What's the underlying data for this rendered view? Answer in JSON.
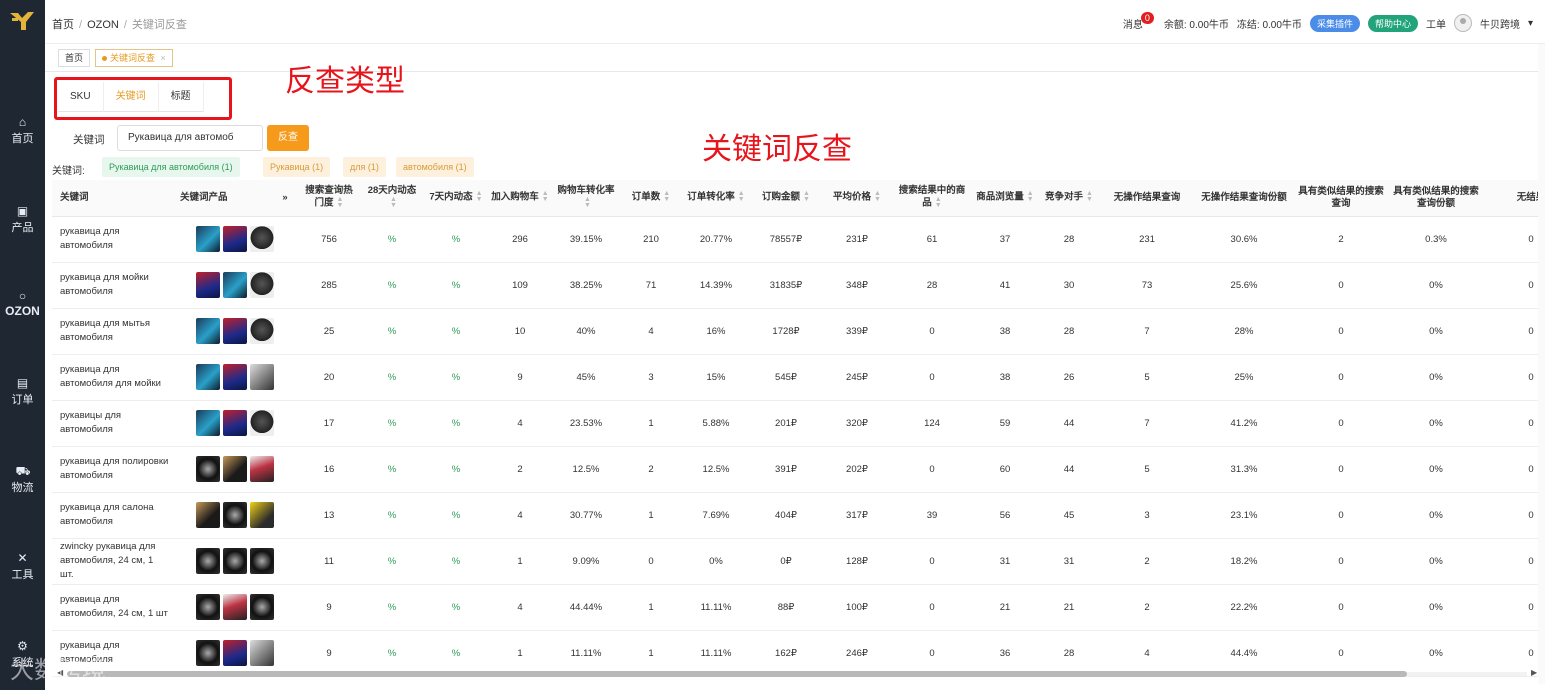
{
  "sidebar": {
    "items": [
      {
        "label": "首页",
        "icon": "home-icon"
      },
      {
        "label": "产品",
        "icon": "briefcase-icon"
      },
      {
        "label": "OZON",
        "icon": "ozon-icon"
      },
      {
        "label": "订单",
        "icon": "document-icon"
      },
      {
        "label": "物流",
        "icon": "truck-icon"
      },
      {
        "label": "工具",
        "icon": "tools-icon"
      },
      {
        "label": "系统",
        "icon": "gear-icon"
      }
    ]
  },
  "breadcrumb": [
    "首页",
    "OZON",
    "关键词反查"
  ],
  "header": {
    "messages_label": "消息",
    "messages_count": "0",
    "balance": "余额: 0.00牛币",
    "frozen": "冻结: 0.00牛币",
    "plugin_btn": "采集插件",
    "help_btn": "帮助中心",
    "ticket": "工单",
    "user": "牛贝跨境"
  },
  "page_tabs": [
    {
      "label": "首页",
      "active": false
    },
    {
      "label": "关键词反查",
      "active": true,
      "close": "×"
    }
  ],
  "query_tabs": [
    {
      "label": "SKU",
      "active": false
    },
    {
      "label": "关键词",
      "active": true
    },
    {
      "label": "标题",
      "active": false
    }
  ],
  "annotations": {
    "query_type": "反查类型",
    "keyword_lookup": "关键词反查"
  },
  "search": {
    "label": "关键词",
    "value": "Рукавица для автомоб",
    "button": "反查"
  },
  "chips": {
    "label": "关键词:",
    "items": [
      {
        "text": "Рукавица для автомобиля (1)",
        "style": "green"
      },
      {
        "text": "Рукавица (1)",
        "style": "orange"
      },
      {
        "text": "для (1)",
        "style": "orange"
      },
      {
        "text": "автомобиля (1)",
        "style": "orange"
      }
    ]
  },
  "table": {
    "headers": [
      "关键词",
      "关键词产品",
      "»",
      "搜索查询热门度",
      "28天内动态",
      "7天内动态",
      "加入购物车",
      "购物车转化率",
      "订单数",
      "订单转化率",
      "订购金额",
      "平均价格",
      "搜索结果中的商品",
      "商品浏览量",
      "竞争对手",
      "无操作结果查询",
      "无操作结果查询份额",
      "具有类似结果的搜索查询",
      "具有类似结果的搜索查询份额",
      "无结果"
    ],
    "rows": [
      {
        "keyword": "рукавица для автомобиля",
        "thumbs": [
          "t1",
          "t2",
          "t3"
        ],
        "popularity": "756",
        "d28": "%",
        "d7": "%",
        "cart": "296",
        "cart_rate": "39.15%",
        "orders": "210",
        "order_rate": "20.77%",
        "amount": "78557₽",
        "avg": "231₽",
        "results": "61",
        "views": "37",
        "competitors": "28",
        "noop": "231",
        "noop_share": "30.6%",
        "similar": "2",
        "similar_share": "0.3%",
        "last": "0"
      },
      {
        "keyword": "рукавица для мойки автомобиля",
        "thumbs": [
          "t2",
          "t1",
          "t3"
        ],
        "popularity": "285",
        "d28": "%",
        "d7": "%",
        "cart": "109",
        "cart_rate": "38.25%",
        "orders": "71",
        "order_rate": "14.39%",
        "amount": "31835₽",
        "avg": "348₽",
        "results": "28",
        "views": "41",
        "competitors": "30",
        "noop": "73",
        "noop_share": "25.6%",
        "similar": "0",
        "similar_share": "0%",
        "last": "0"
      },
      {
        "keyword": "рукавица для мытья автомобиля",
        "thumbs": [
          "t1",
          "t2",
          "t3"
        ],
        "popularity": "25",
        "d28": "%",
        "d7": "%",
        "cart": "10",
        "cart_rate": "40%",
        "orders": "4",
        "order_rate": "16%",
        "amount": "1728₽",
        "avg": "339₽",
        "results": "0",
        "views": "38",
        "competitors": "28",
        "noop": "7",
        "noop_share": "28%",
        "similar": "0",
        "similar_share": "0%",
        "last": "0"
      },
      {
        "keyword": "рукавица для автомобиля для мойки",
        "thumbs": [
          "t1",
          "t2",
          "t4"
        ],
        "popularity": "20",
        "d28": "%",
        "d7": "%",
        "cart": "9",
        "cart_rate": "45%",
        "orders": "3",
        "order_rate": "15%",
        "amount": "545₽",
        "avg": "245₽",
        "results": "0",
        "views": "38",
        "competitors": "26",
        "noop": "5",
        "noop_share": "25%",
        "similar": "0",
        "similar_share": "0%",
        "last": "0"
      },
      {
        "keyword": "рукавицы для автомобиля",
        "thumbs": [
          "t1",
          "t2",
          "t3"
        ],
        "popularity": "17",
        "d28": "%",
        "d7": "%",
        "cart": "4",
        "cart_rate": "23.53%",
        "orders": "1",
        "order_rate": "5.88%",
        "amount": "201₽",
        "avg": "320₽",
        "results": "124",
        "views": "59",
        "competitors": "44",
        "noop": "7",
        "noop_share": "41.2%",
        "similar": "0",
        "similar_share": "0%",
        "last": "0"
      },
      {
        "keyword": "рукавица для полировки автомобиля",
        "thumbs": [
          "t7",
          "t6",
          "t8"
        ],
        "popularity": "16",
        "d28": "%",
        "d7": "%",
        "cart": "2",
        "cart_rate": "12.5%",
        "orders": "2",
        "order_rate": "12.5%",
        "amount": "391₽",
        "avg": "202₽",
        "results": "0",
        "views": "60",
        "competitors": "44",
        "noop": "5",
        "noop_share": "31.3%",
        "similar": "0",
        "similar_share": "0%",
        "last": "0"
      },
      {
        "keyword": "рукавица для салона автомобиля",
        "thumbs": [
          "t6",
          "t7",
          "t5"
        ],
        "popularity": "13",
        "d28": "%",
        "d7": "%",
        "cart": "4",
        "cart_rate": "30.77%",
        "orders": "1",
        "order_rate": "7.69%",
        "amount": "404₽",
        "avg": "317₽",
        "results": "39",
        "views": "56",
        "competitors": "45",
        "noop": "3",
        "noop_share": "23.1%",
        "similar": "0",
        "similar_share": "0%",
        "last": "0"
      },
      {
        "keyword": "zwincky рукавица для автомобиля, 24 см, 1 шт.",
        "thumbs": [
          "t7",
          "t7",
          "t7"
        ],
        "popularity": "11",
        "d28": "%",
        "d7": "%",
        "cart": "1",
        "cart_rate": "9.09%",
        "orders": "0",
        "order_rate": "0%",
        "amount": "0₽",
        "avg": "128₽",
        "results": "0",
        "views": "31",
        "competitors": "31",
        "noop": "2",
        "noop_share": "18.2%",
        "similar": "0",
        "similar_share": "0%",
        "last": "0"
      },
      {
        "keyword": "рукавица для автомобиля, 24 см, 1 шт",
        "thumbs": [
          "t7",
          "t8",
          "t7"
        ],
        "popularity": "9",
        "d28": "%",
        "d7": "%",
        "cart": "4",
        "cart_rate": "44.44%",
        "orders": "1",
        "order_rate": "11.11%",
        "amount": "88₽",
        "avg": "100₽",
        "results": "0",
        "views": "21",
        "competitors": "21",
        "noop": "2",
        "noop_share": "22.2%",
        "similar": "0",
        "similar_share": "0%",
        "last": "0"
      },
      {
        "keyword": "рукавица для автомобиля",
        "thumbs": [
          "t7",
          "t2",
          "t4"
        ],
        "popularity": "9",
        "d28": "%",
        "d7": "%",
        "cart": "1",
        "cart_rate": "11.11%",
        "orders": "1",
        "order_rate": "11.11%",
        "amount": "162₽",
        "avg": "246₽",
        "results": "0",
        "views": "36",
        "competitors": "28",
        "noop": "4",
        "noop_share": "44.4%",
        "similar": "0",
        "similar_share": "0%",
        "last": "0"
      }
    ]
  },
  "watermark": "大数跨境"
}
